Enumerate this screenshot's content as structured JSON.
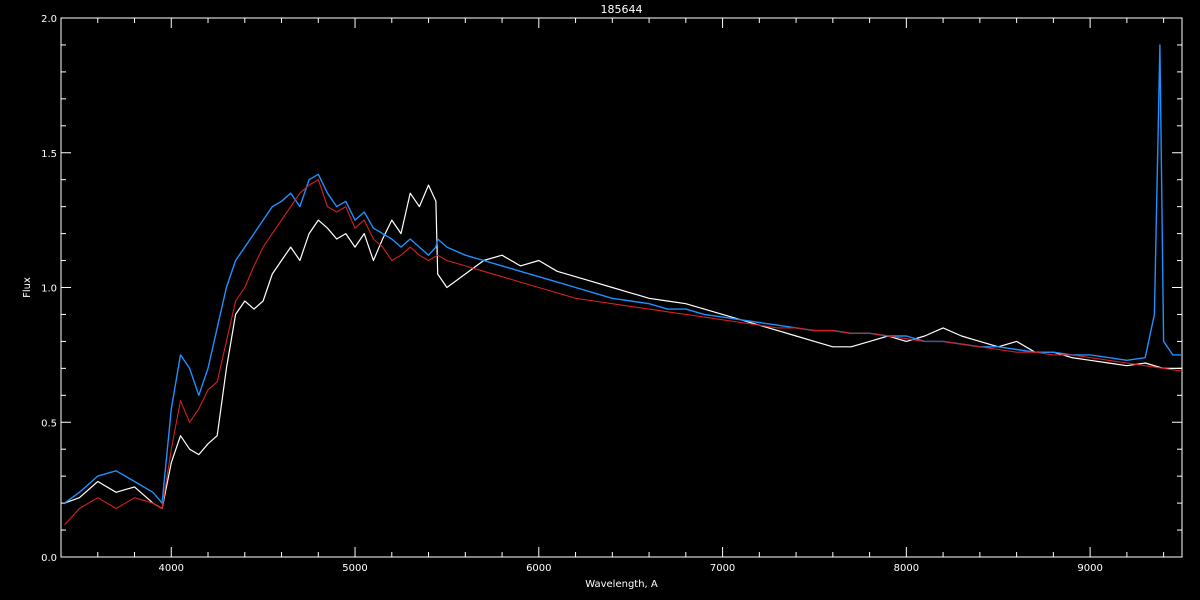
{
  "chart_data": {
    "type": "line",
    "title": "185644",
    "xlabel": "Wavelength, A",
    "ylabel": "Flux",
    "xlim": [
      3400,
      9500
    ],
    "ylim": [
      0.0,
      2.0
    ],
    "x_ticks": [
      4000,
      5000,
      6000,
      7000,
      8000,
      9000
    ],
    "y_ticks": [
      0.0,
      0.5,
      1.0,
      1.5,
      2.0
    ],
    "x_tick_labels": [
      "4000",
      "5000",
      "6000",
      "7000",
      "8000",
      "9000"
    ],
    "y_tick_labels": [
      "0.0",
      "0.5",
      "1.0",
      "1.5",
      "2.0"
    ],
    "grid": false,
    "colors": {
      "background": "#000000",
      "axes": "#ffffff",
      "series_white": "#ffffff",
      "series_blue": "#1e90ff",
      "series_red": "#d62020"
    },
    "series": [
      {
        "color": "#ffffff",
        "x": [
          3420,
          3500,
          3600,
          3700,
          3800,
          3900,
          3950,
          4000,
          4050,
          4100,
          4150,
          4200,
          4250,
          4300,
          4350,
          4400,
          4450,
          4500,
          4550,
          4600,
          4650,
          4700,
          4750,
          4800,
          4850,
          4900,
          4950,
          5000,
          5050,
          5100,
          5150,
          5200,
          5250,
          5300,
          5350,
          5400,
          5440,
          5450,
          5500,
          5600,
          5700,
          5800,
          5900,
          6000,
          6100,
          6200,
          6300,
          6400,
          6500,
          6600,
          6700,
          6800,
          6900,
          7000,
          7100,
          7200,
          7300,
          7400,
          7500,
          7600,
          7700,
          7800,
          7900,
          8000,
          8100,
          8200,
          8300,
          8400,
          8500,
          8600,
          8700,
          8800,
          8900,
          9000,
          9100,
          9200,
          9300,
          9400,
          9500
        ],
        "y": [
          0.2,
          0.22,
          0.28,
          0.24,
          0.26,
          0.2,
          0.18,
          0.35,
          0.45,
          0.4,
          0.38,
          0.42,
          0.45,
          0.7,
          0.9,
          0.95,
          0.92,
          0.95,
          1.05,
          1.1,
          1.15,
          1.1,
          1.2,
          1.25,
          1.22,
          1.18,
          1.2,
          1.15,
          1.2,
          1.1,
          1.18,
          1.25,
          1.2,
          1.35,
          1.3,
          1.38,
          1.32,
          1.05,
          1.0,
          1.05,
          1.1,
          1.12,
          1.08,
          1.1,
          1.06,
          1.04,
          1.02,
          1.0,
          0.98,
          0.96,
          0.95,
          0.94,
          0.92,
          0.9,
          0.88,
          0.86,
          0.84,
          0.82,
          0.8,
          0.78,
          0.78,
          0.8,
          0.82,
          0.8,
          0.82,
          0.85,
          0.82,
          0.8,
          0.78,
          0.8,
          0.76,
          0.76,
          0.74,
          0.73,
          0.72,
          0.71,
          0.72,
          0.7,
          0.7
        ]
      },
      {
        "color": "#1e90ff",
        "x": [
          3420,
          3500,
          3600,
          3700,
          3800,
          3900,
          3950,
          4000,
          4050,
          4100,
          4150,
          4200,
          4250,
          4300,
          4350,
          4400,
          4450,
          4500,
          4550,
          4600,
          4650,
          4700,
          4750,
          4800,
          4850,
          4900,
          4950,
          5000,
          5050,
          5100,
          5150,
          5200,
          5250,
          5300,
          5350,
          5400,
          5440,
          5450,
          5500,
          5600,
          5700,
          5800,
          5900,
          6000,
          6100,
          6200,
          6300,
          6400,
          6500,
          6600,
          6700,
          6800,
          6900,
          7000,
          7100,
          7200,
          7300,
          7400,
          7500,
          7600,
          7700,
          7800,
          7900,
          8000,
          8100,
          8200,
          8300,
          8400,
          8500,
          8600,
          8700,
          8800,
          8900,
          9000,
          9100,
          9200,
          9300,
          9350,
          9380,
          9400,
          9450,
          9500
        ],
        "y": [
          0.2,
          0.24,
          0.3,
          0.32,
          0.28,
          0.24,
          0.2,
          0.55,
          0.75,
          0.7,
          0.6,
          0.7,
          0.85,
          1.0,
          1.1,
          1.15,
          1.2,
          1.25,
          1.3,
          1.32,
          1.35,
          1.3,
          1.4,
          1.42,
          1.35,
          1.3,
          1.32,
          1.25,
          1.28,
          1.22,
          1.2,
          1.18,
          1.15,
          1.18,
          1.15,
          1.12,
          1.15,
          1.18,
          1.15,
          1.12,
          1.1,
          1.08,
          1.06,
          1.04,
          1.02,
          1.0,
          0.98,
          0.96,
          0.95,
          0.94,
          0.92,
          0.92,
          0.9,
          0.89,
          0.88,
          0.87,
          0.86,
          0.85,
          0.84,
          0.84,
          0.83,
          0.83,
          0.82,
          0.82,
          0.8,
          0.8,
          0.79,
          0.78,
          0.78,
          0.77,
          0.76,
          0.76,
          0.75,
          0.75,
          0.74,
          0.73,
          0.74,
          0.9,
          1.9,
          0.8,
          0.75,
          0.75
        ]
      },
      {
        "color": "#d62020",
        "x": [
          3420,
          3500,
          3600,
          3700,
          3800,
          3900,
          3950,
          4000,
          4050,
          4100,
          4150,
          4200,
          4250,
          4300,
          4350,
          4400,
          4450,
          4500,
          4550,
          4600,
          4650,
          4700,
          4750,
          4800,
          4850,
          4900,
          4950,
          5000,
          5050,
          5100,
          5150,
          5200,
          5250,
          5300,
          5350,
          5400,
          5450,
          5500,
          5600,
          5700,
          5800,
          5900,
          6000,
          6100,
          6200,
          6300,
          6400,
          6500,
          6600,
          6700,
          6800,
          6900,
          7000,
          7100,
          7200,
          7300,
          7400,
          7500,
          7600,
          7700,
          7800,
          7900,
          8000,
          8100,
          8200,
          8300,
          8400,
          8500,
          8600,
          8700,
          8800,
          8900,
          9000,
          9100,
          9200,
          9300,
          9400,
          9500
        ],
        "y": [
          0.12,
          0.18,
          0.22,
          0.18,
          0.22,
          0.2,
          0.18,
          0.4,
          0.58,
          0.5,
          0.55,
          0.62,
          0.65,
          0.8,
          0.95,
          1.0,
          1.08,
          1.15,
          1.2,
          1.25,
          1.3,
          1.35,
          1.38,
          1.4,
          1.3,
          1.28,
          1.3,
          1.22,
          1.25,
          1.18,
          1.15,
          1.1,
          1.12,
          1.15,
          1.12,
          1.1,
          1.12,
          1.1,
          1.08,
          1.06,
          1.04,
          1.02,
          1.0,
          0.98,
          0.96,
          0.95,
          0.94,
          0.93,
          0.92,
          0.91,
          0.9,
          0.89,
          0.88,
          0.87,
          0.86,
          0.85,
          0.85,
          0.84,
          0.84,
          0.83,
          0.83,
          0.82,
          0.81,
          0.8,
          0.8,
          0.79,
          0.78,
          0.77,
          0.76,
          0.76,
          0.75,
          0.75,
          0.74,
          0.73,
          0.72,
          0.71,
          0.7,
          0.69
        ]
      }
    ]
  }
}
